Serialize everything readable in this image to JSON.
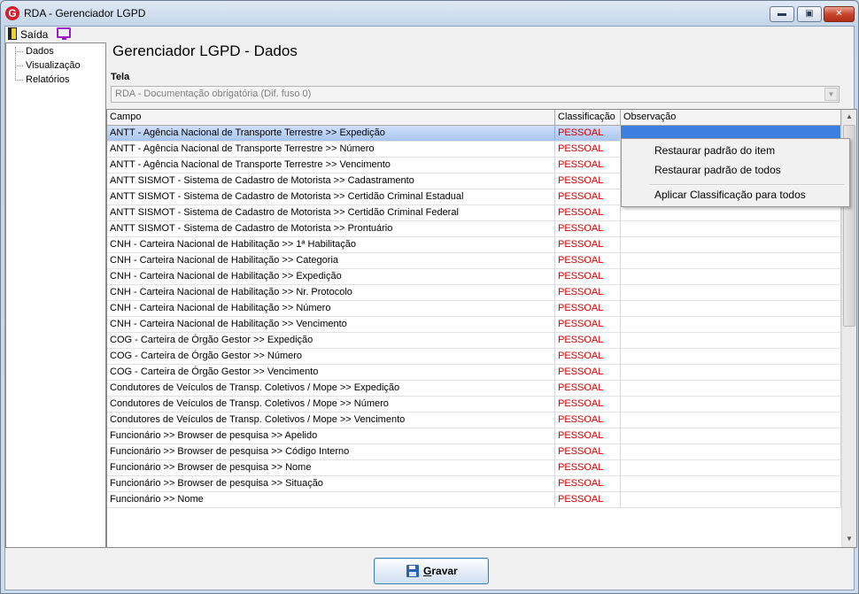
{
  "window": {
    "title": "RDA - Gerenciador LGPD",
    "icon_letter": "G",
    "controls": {
      "minimize": "▬",
      "maximize": "▣",
      "close": "✕"
    }
  },
  "menubar": {
    "exit_label": "Saída",
    "exit_icon": "door-exit-icon",
    "screen_icon": "monitor-icon"
  },
  "tree": {
    "items": [
      "Dados",
      "Visualização",
      "Relatórios"
    ]
  },
  "page": {
    "heading": "Gerenciador LGPD - Dados"
  },
  "tela": {
    "label": "Tela",
    "selected": "RDA - Documentação obrigatória (Dif. fuso 0)",
    "dropdown_glyph": "▼"
  },
  "grid": {
    "columns": [
      "Campo",
      "Classificação",
      "Observação"
    ],
    "rows": [
      {
        "campo": "ANTT - Agência Nacional de Transporte Terrestre >> Expedição",
        "classificacao": "PESSOAL",
        "observacao": ""
      },
      {
        "campo": "ANTT - Agência Nacional de Transporte Terrestre >> Número",
        "classificacao": "PESSOAL",
        "observacao": ""
      },
      {
        "campo": "ANTT - Agência Nacional de Transporte Terrestre >> Vencimento",
        "classificacao": "PESSOAL",
        "observacao": ""
      },
      {
        "campo": "ANTT SISMOT - Sistema de Cadastro de Motorista >> Cadastramento",
        "classificacao": "PESSOAL",
        "observacao": ""
      },
      {
        "campo": "ANTT SISMOT - Sistema de Cadastro de Motorista >> Certidão Criminal Estadual",
        "classificacao": "PESSOAL",
        "observacao": ""
      },
      {
        "campo": "ANTT SISMOT - Sistema de Cadastro de Motorista >> Certidão Criminal Federal",
        "classificacao": "PESSOAL",
        "observacao": ""
      },
      {
        "campo": "ANTT SISMOT - Sistema de Cadastro de Motorista >> Prontuário",
        "classificacao": "PESSOAL",
        "observacao": ""
      },
      {
        "campo": "CNH - Carteira Nacional de Habilitação >> 1ª Habilitação",
        "classificacao": "PESSOAL",
        "observacao": ""
      },
      {
        "campo": "CNH - Carteira Nacional de Habilitação >> Categoria",
        "classificacao": "PESSOAL",
        "observacao": ""
      },
      {
        "campo": "CNH - Carteira Nacional de Habilitação >> Expedição",
        "classificacao": "PESSOAL",
        "observacao": ""
      },
      {
        "campo": "CNH - Carteira Nacional de Habilitação >> Nr. Protocolo",
        "classificacao": "PESSOAL",
        "observacao": ""
      },
      {
        "campo": "CNH - Carteira Nacional de Habilitação >> Número",
        "classificacao": "PESSOAL",
        "observacao": ""
      },
      {
        "campo": "CNH - Carteira Nacional de Habilitação >> Vencimento",
        "classificacao": "PESSOAL",
        "observacao": ""
      },
      {
        "campo": "COG - Carteira de Órgão Gestor >> Expedição",
        "classificacao": "PESSOAL",
        "observacao": ""
      },
      {
        "campo": "COG - Carteira de Órgão Gestor >> Número",
        "classificacao": "PESSOAL",
        "observacao": ""
      },
      {
        "campo": "COG - Carteira de Órgão Gestor >> Vencimento",
        "classificacao": "PESSOAL",
        "observacao": ""
      },
      {
        "campo": "Condutores de Veículos de Transp. Coletivos / Mope >> Expedição",
        "classificacao": "PESSOAL",
        "observacao": ""
      },
      {
        "campo": "Condutores de Veículos de Transp. Coletivos / Mope >> Número",
        "classificacao": "PESSOAL",
        "observacao": ""
      },
      {
        "campo": "Condutores de Veículos de Transp. Coletivos / Mope >> Vencimento",
        "classificacao": "PESSOAL",
        "observacao": ""
      },
      {
        "campo": "Funcionário >> Browser de pesquisa >> Apelido",
        "classificacao": "PESSOAL",
        "observacao": ""
      },
      {
        "campo": "Funcionário >> Browser de pesquisa >> Código Interno",
        "classificacao": "PESSOAL",
        "observacao": ""
      },
      {
        "campo": "Funcionário >> Browser de pesquisa >> Nome",
        "classificacao": "PESSOAL",
        "observacao": ""
      },
      {
        "campo": "Funcionário >> Browser de pesquisa >> Situação",
        "classificacao": "PESSOAL",
        "observacao": ""
      },
      {
        "campo": "Funcionário >> Nome",
        "classificacao": "PESSOAL",
        "observacao": ""
      }
    ],
    "selected_row": 0
  },
  "context_menu": {
    "items": [
      "Restaurar padrão do item",
      "Restaurar padrão de todos",
      "Aplicar Classificação para todos"
    ]
  },
  "save_button": {
    "accel": "G",
    "rest": "ravar",
    "icon": "floppy-disk-icon"
  },
  "colors": {
    "classification_text": "#d40000",
    "selection": "#a9c5f2",
    "menu_icon": "#9b1fc7"
  }
}
